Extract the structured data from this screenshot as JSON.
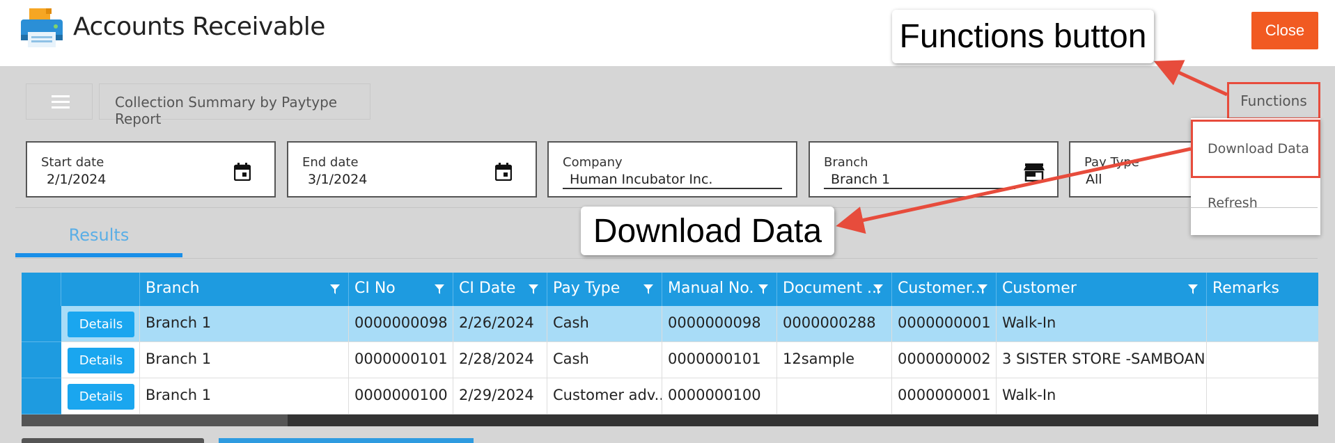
{
  "app": {
    "title": "Accounts Receivable",
    "close_label": "Close"
  },
  "breadcrumb": "Collection Summary by Paytype Report",
  "functions_label": "Functions",
  "functions_menu": {
    "items": [
      {
        "label": "Download Data"
      },
      {
        "label": "Refresh"
      }
    ]
  },
  "filters": [
    {
      "label": "Start date",
      "value": "2/1/2024",
      "icon": "calendar-icon"
    },
    {
      "label": "End date",
      "value": "3/1/2024",
      "icon": "calendar-icon"
    },
    {
      "label": "Company",
      "value": "Human Incubator Inc.",
      "icon": ""
    },
    {
      "label": "Branch",
      "value": "Branch 1",
      "icon": "store-icon"
    },
    {
      "label": "Pay Type",
      "value": "All",
      "icon": ""
    }
  ],
  "tabs": [
    {
      "label": "Results",
      "active": true
    }
  ],
  "grid": {
    "columns": [
      "Branch",
      "CI No",
      "CI Date",
      "Pay Type",
      "Manual No.",
      "Document ...",
      "Customer...",
      "Customer",
      "Remarks"
    ],
    "details_label": "Details",
    "rows": [
      {
        "selected": true,
        "cells": [
          "Branch 1",
          "0000000098",
          "2/26/2024",
          "Cash",
          "0000000098",
          "0000000288",
          "0000000001",
          "Walk-In",
          ""
        ]
      },
      {
        "selected": false,
        "cells": [
          "Branch 1",
          "0000000101",
          "2/28/2024",
          "Cash",
          "0000000101",
          "12sample",
          "0000000002",
          "3 SISTER STORE -SAMBOAN",
          ""
        ]
      },
      {
        "selected": false,
        "cells": [
          "Branch 1",
          "0000000100",
          "2/29/2024",
          "Customer adv...",
          "0000000100",
          "",
          "0000000001",
          "Walk-In",
          ""
        ]
      }
    ]
  },
  "annotations": {
    "functions_callout": "Functions button",
    "download_callout": "Download Data"
  },
  "colors": {
    "accent": "#1e9be0",
    "close": "#f15a22",
    "highlight": "#e74c3c",
    "selected_row": "#a8dcf7"
  }
}
